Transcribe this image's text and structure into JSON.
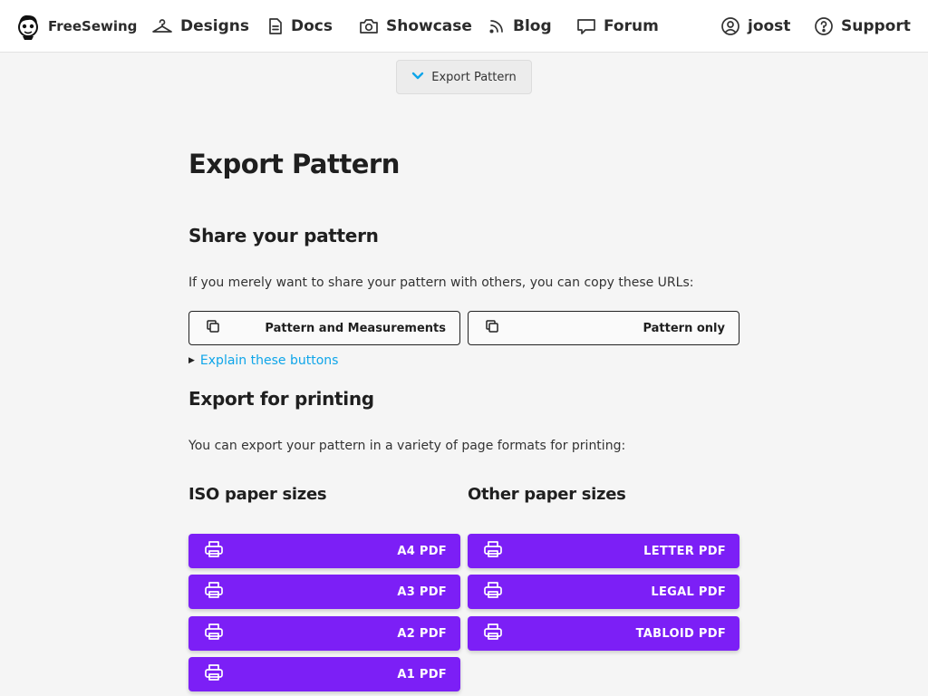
{
  "nav": {
    "brand": "FreeSewing",
    "items": [
      {
        "label": "Designs",
        "icon": "hanger-icon"
      },
      {
        "label": "Docs",
        "icon": "document-icon"
      },
      {
        "label": "Showcase",
        "icon": "camera-icon"
      },
      {
        "label": "Blog",
        "icon": "rss-icon"
      },
      {
        "label": "Forum",
        "icon": "chat-icon"
      }
    ],
    "user": {
      "label": "joost",
      "icon": "user-icon"
    },
    "support": {
      "label": "Support",
      "icon": "help-icon"
    }
  },
  "toggle": {
    "label": "Export Pattern",
    "icon": "chevron-down-icon"
  },
  "main": {
    "title": "Export Pattern",
    "share": {
      "heading": "Share your pattern",
      "intro": "If you merely want to share your pattern with others, you can copy these URLs:",
      "buttons": [
        "Pattern and Measurements",
        "Pattern only"
      ],
      "explain": "Explain these buttons"
    },
    "print": {
      "heading": "Export for printing",
      "intro": "You can export your pattern in a variety of page formats for printing:",
      "iso": {
        "heading": "ISO paper sizes",
        "buttons": [
          "A4 PDF",
          "A3 PDF",
          "A2 PDF",
          "A1 PDF"
        ]
      },
      "other": {
        "heading": "Other paper sizes",
        "buttons": [
          "LETTER PDF",
          "LEGAL PDF",
          "TABLOID PDF"
        ]
      }
    }
  },
  "colors": {
    "accent": "#7c1ff6",
    "link": "#0ea5e9",
    "background": "#f5f5f5"
  }
}
